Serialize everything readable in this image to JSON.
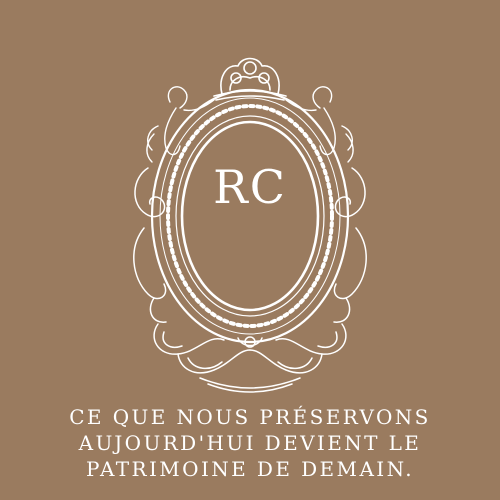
{
  "colors": {
    "background": "#9a7b5f",
    "ornament": "#ffffff",
    "text": "#ffffff"
  },
  "logo": {
    "monogram": "RC",
    "ornament": "baroque-oval-frame"
  },
  "tagline": {
    "lines": [
      "CE QUE NOUS PRÉSERVONS",
      "AUJOURD'HUI DEVIENT LE",
      "PATRIMOINE DE DEMAIN."
    ]
  }
}
